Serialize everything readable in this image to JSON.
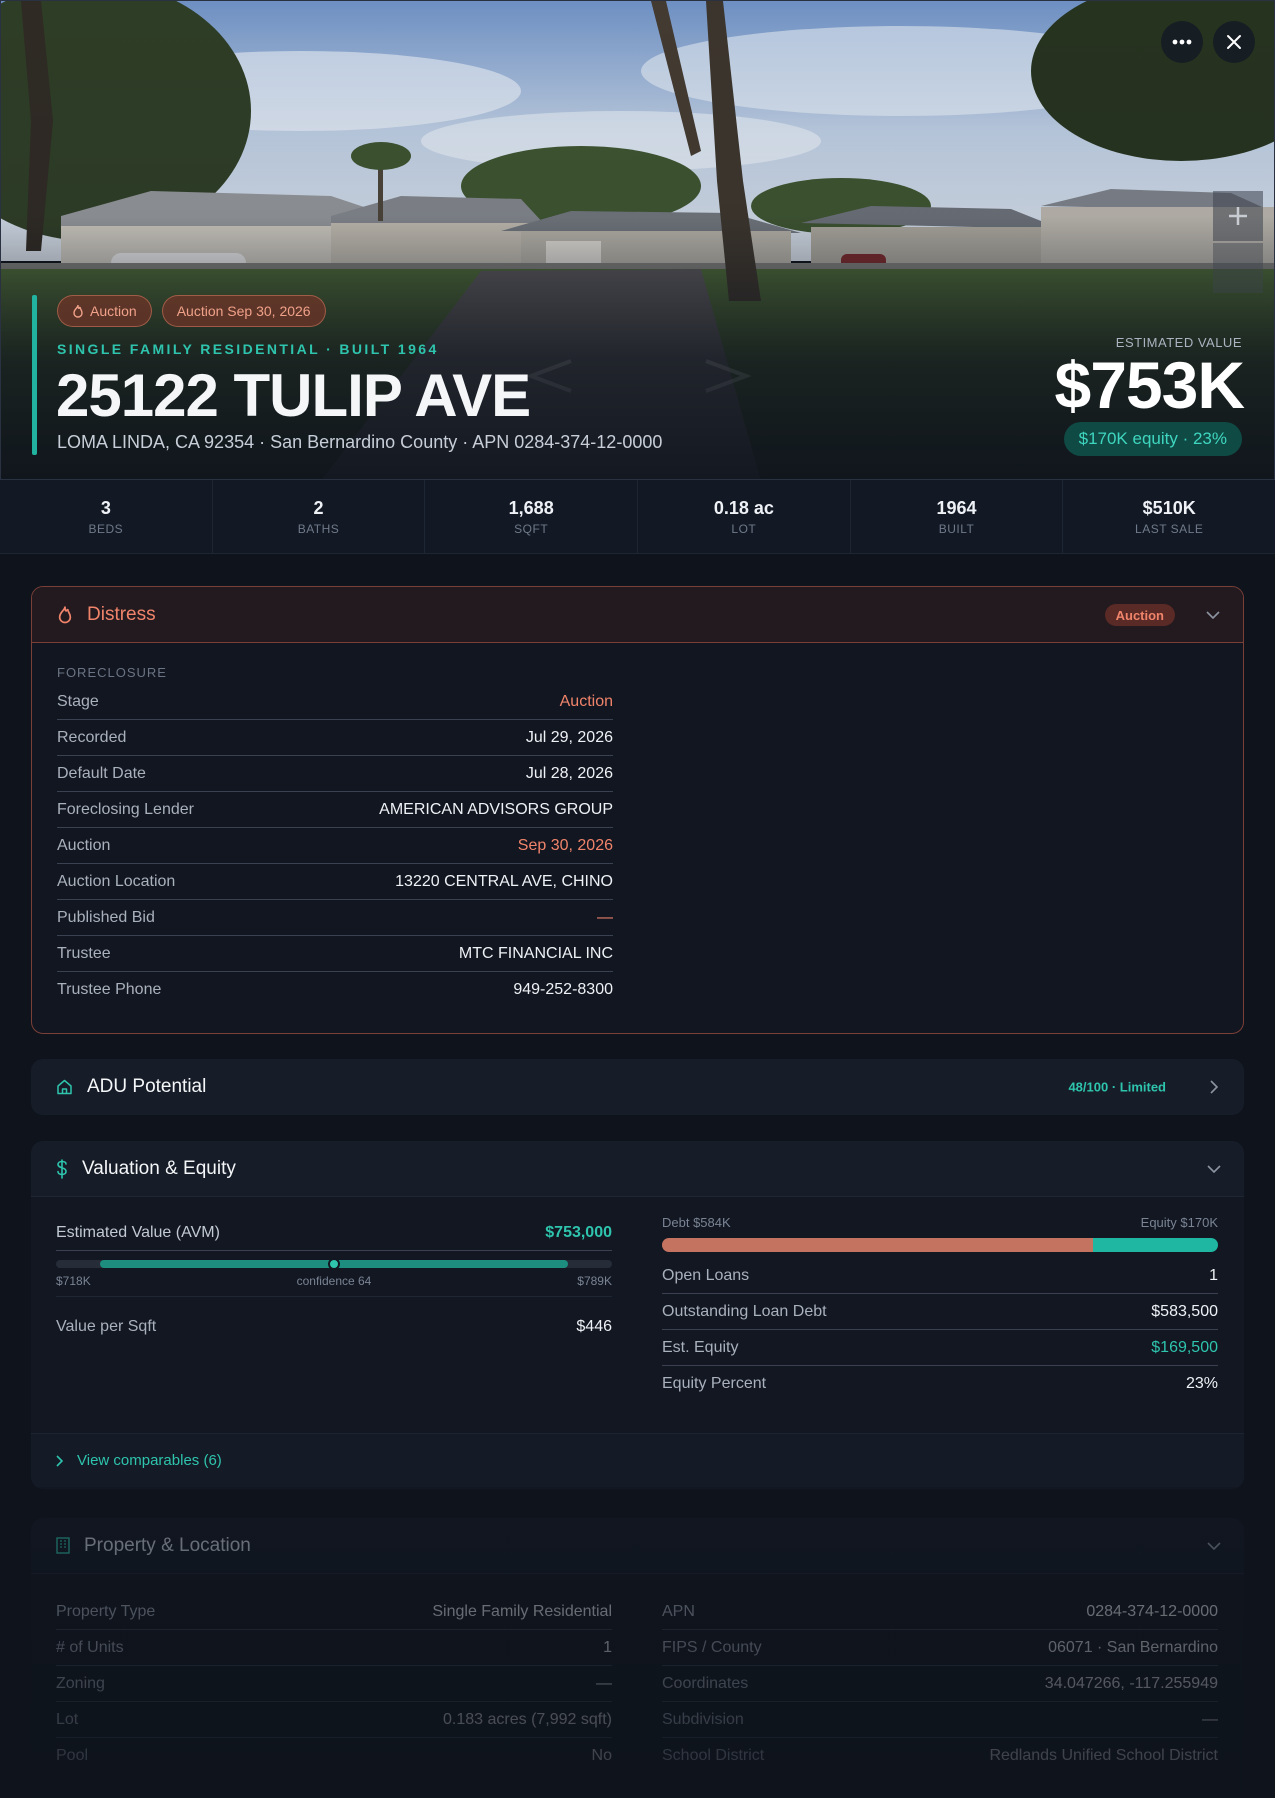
{
  "hero": {
    "chip_auction": "Auction",
    "chip_auction_date": "Auction Sep 30, 2026",
    "subtitle": "SINGLE FAMILY RESIDENTIAL · BUILT 1964",
    "title": "25122 TULIP AVE",
    "address_line": "LOMA LINDA, CA 92354 · San Bernardino County · APN 0284-374-12-0000",
    "estimated_label": "ESTIMATED VALUE",
    "estimated_value": "$753K",
    "equity_pill": "$170K equity · 23%",
    "more_icon": "more-dots-icon",
    "close_icon": "close-icon"
  },
  "stats": [
    {
      "value": "3",
      "label": "BEDS"
    },
    {
      "value": "2",
      "label": "BATHS"
    },
    {
      "value": "1,688",
      "label": "SQFT"
    },
    {
      "value": "0.18 ac",
      "label": "LOT"
    },
    {
      "value": "1964",
      "label": "BUILT"
    },
    {
      "value": "$510K",
      "label": "LAST SALE"
    }
  ],
  "distress": {
    "title": "Distress",
    "badge": "Auction",
    "section": "FORECLOSURE",
    "rows": [
      {
        "k": "Stage",
        "v": "Auction"
      },
      {
        "k": "Recorded",
        "v": "Jul 29, 2026"
      },
      {
        "k": "Default Date",
        "v": "Jul 28, 2026"
      },
      {
        "k": "Foreclosing Lender",
        "v": "AMERICAN ADVISORS GROUP"
      },
      {
        "k": "Auction",
        "v": "Sep 30, 2026"
      },
      {
        "k": "Auction Location",
        "v": "13220 CENTRAL AVE, CHINO"
      },
      {
        "k": "Published Bid",
        "v": "—"
      },
      {
        "k": "Trustee",
        "v": "MTC FINANCIAL INC"
      },
      {
        "k": "Trustee Phone",
        "v": "949-252-8300"
      }
    ]
  },
  "adu": {
    "title": "ADU Potential",
    "score": "48/100 · Limited"
  },
  "valuation": {
    "title": "Valuation & Equity",
    "avm_label": "Estimated Value (AVM)",
    "avm_value": "$753,000",
    "range_low": "$718K",
    "confidence": "confidence 64",
    "range_high": "$789K",
    "avm_position": 0.5,
    "per_sqft_label": "Value per Sqft",
    "per_sqft_value": "$446",
    "debt_caption": "Debt $584K",
    "equity_caption": "Equity $170K",
    "debt_fraction": 0.775,
    "rows": [
      {
        "k": "Open Loans",
        "v": "1"
      },
      {
        "k": "Outstanding Loan Debt",
        "v": "$583,500"
      },
      {
        "k": "Est. Equity",
        "v": "$169,500"
      },
      {
        "k": "Equity Percent",
        "v": "23%"
      }
    ],
    "comparables": "View comparables (6)"
  },
  "property": {
    "title": "Property & Location",
    "left": [
      {
        "k": "Property Type",
        "v": "Single Family Residential"
      },
      {
        "k": "# of Units",
        "v": "1"
      },
      {
        "k": "Zoning",
        "v": "—"
      },
      {
        "k": "Lot",
        "v": "0.183 acres (7,992 sqft)"
      },
      {
        "k": "Pool",
        "v": "No"
      }
    ],
    "right": [
      {
        "k": "APN",
        "v": "0284-374-12-0000"
      },
      {
        "k": "FIPS / County",
        "v": "06071 · San Bernardino"
      },
      {
        "k": "Coordinates",
        "v": "34.047266, -117.255949"
      },
      {
        "k": "Subdivision",
        "v": "—"
      },
      {
        "k": "School District",
        "v": "Redlands Unified School District"
      }
    ]
  },
  "colors": {
    "accent": "#22b3a0",
    "distress": "#f0846b",
    "debt": "#c57361"
  }
}
